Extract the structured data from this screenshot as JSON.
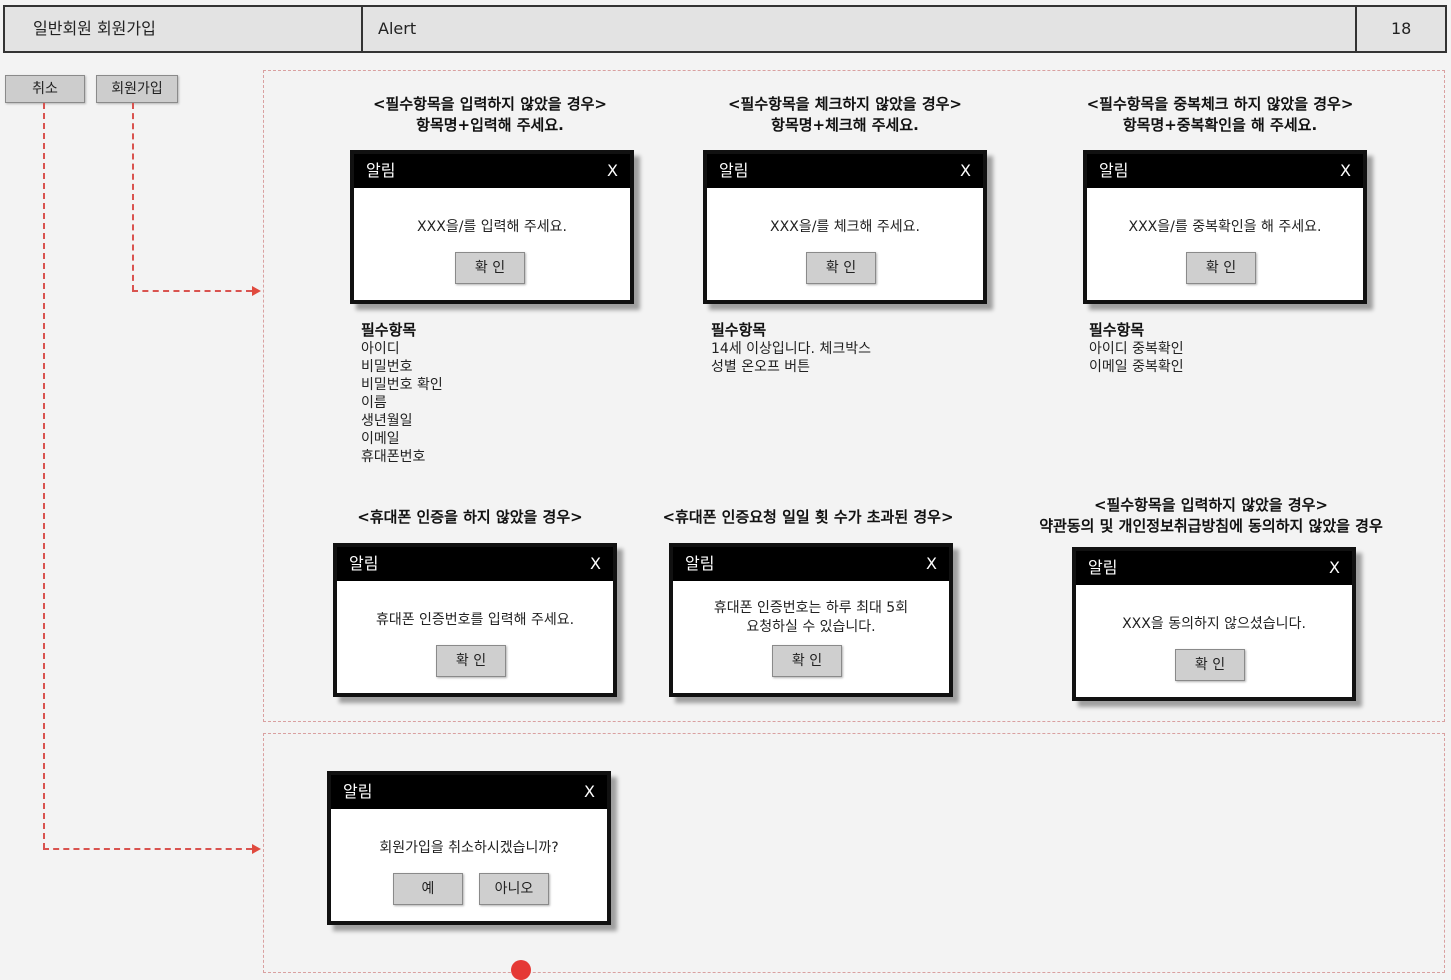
{
  "header": {
    "title": "일반회원 회원가입",
    "section": "Alert",
    "page_number": "18"
  },
  "top_buttons": {
    "cancel": "취소",
    "signup": "회원가입"
  },
  "alerts": [
    {
      "caption_line1": "<필수항목을 입력하지 않았을 경우>",
      "caption_line2": "항목명+입력해 주세요.",
      "title": "알림",
      "close": "X",
      "message": "XXX을/를 입력해 주세요.",
      "button": "확 인",
      "list_title": "필수항목",
      "list_items": [
        "아이디",
        "비밀번호",
        "비밀번호 확인",
        "이름",
        "생년월일",
        "이메일",
        "휴대폰번호"
      ]
    },
    {
      "caption_line1": "<필수항목을 체크하지 않았을 경우>",
      "caption_line2": "항목명+체크해 주세요.",
      "title": "알림",
      "close": "X",
      "message": "XXX을/를 체크해 주세요.",
      "button": "확 인",
      "list_title": "필수항목",
      "list_items": [
        "14세 이상입니다. 체크박스",
        "성별 온오프 버튼"
      ]
    },
    {
      "caption_line1": "<필수항목을 중복체크 하지 않았을 경우>",
      "caption_line2": "항목명+중복확인을 해 주세요.",
      "title": "알림",
      "close": "X",
      "message": "XXX을/를 중복확인을 해 주세요.",
      "button": "확 인",
      "list_title": "필수항목",
      "list_items": [
        "아이디 중복확인",
        "이메일 중복확인"
      ]
    },
    {
      "caption_line1": "<휴대폰 인증을 하지 않았을 경우>",
      "title": "알림",
      "close": "X",
      "message": "휴대폰 인증번호를 입력해 주세요.",
      "button": "확 인"
    },
    {
      "caption_line1": "<휴대폰 인증요청 일일 횟 수가 초과된 경우>",
      "title": "알림",
      "close": "X",
      "message_line1": "휴대폰 인증번호는 하루 최대 5회",
      "message_line2": "요청하실 수 있습니다.",
      "button": "확 인"
    },
    {
      "caption_line1": "<필수항목을 입력하지 않았을 경우>",
      "caption_line2": "약관동의 및 개인정보취급방침에 동의하지 않았을 경우",
      "title": "알림",
      "close": "X",
      "message": "XXX을 동의하지 않으셨습니다.",
      "button": "확 인"
    }
  ],
  "cancel_dialog": {
    "title": "알림",
    "close": "X",
    "message": "회원가입을 취소하시겠습니까?",
    "yes": "예",
    "no": "아니오"
  },
  "colors": {
    "connector": "#d9534f",
    "dialog_header": "#000000",
    "button": "#cfcfcf"
  }
}
